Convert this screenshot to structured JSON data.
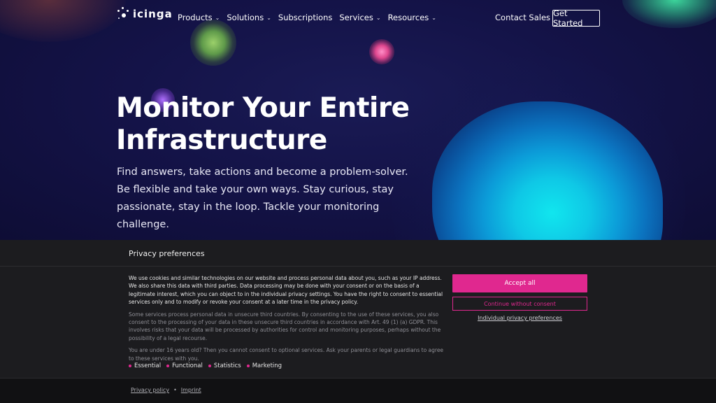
{
  "brand": {
    "name": "icinga"
  },
  "nav": {
    "items": [
      {
        "label": "Products",
        "has_dropdown": true
      },
      {
        "label": "Solutions",
        "has_dropdown": true
      },
      {
        "label": "Subscriptions",
        "has_dropdown": false
      },
      {
        "label": "Services",
        "has_dropdown": true
      },
      {
        "label": "Resources",
        "has_dropdown": true
      }
    ],
    "contact_label": "Contact Sales",
    "cta_label": "Get Started"
  },
  "hero": {
    "title_line1": "Monitor Your Entire",
    "title_line2": "Infrastructure",
    "lead": "Find answers, take actions and become a problem-solver. Be flexible and take your own ways. Stay curious, stay passionate, stay in the loop. Tackle your monitoring challenge."
  },
  "cookie": {
    "title": "Privacy preferences",
    "paragraph1": "We use cookies and similar technologies on our website and process personal data about you, such as your IP address. We also share this data with third parties. Data processing may be done with your consent or on the basis of a legitimate interest, which you can object to in the individual privacy settings. You have the right to consent to essential services only and to modify or revoke your consent at a later time in the privacy policy.",
    "paragraph2": "Some services process personal data in unsecure third countries. By consenting to the use of these services, you also consent to the processing of your data in these unsecure third countries in accordance with Art. 49 (1) (a) GDPR. This involves risks that your data will be processed by authorities for control and monitoring purposes, perhaps without the possibility of a legal recourse.",
    "paragraph3": "You are under 16 years old? Then you cannot consent to optional services. Ask your parents or legal guardians to agree to these services with you.",
    "categories": [
      "Essential",
      "Functional",
      "Statistics",
      "Marketing"
    ],
    "accept_label": "Accept all",
    "continue_label": "Continue without consent",
    "individual_label": "Individual privacy preferences",
    "footer_links": [
      "Privacy policy",
      "Imprint"
    ],
    "footer_separator": "•"
  },
  "colors": {
    "accent": "#e0288f",
    "hero_bg": "#141348",
    "banner_bg": "#1c1c1f"
  }
}
